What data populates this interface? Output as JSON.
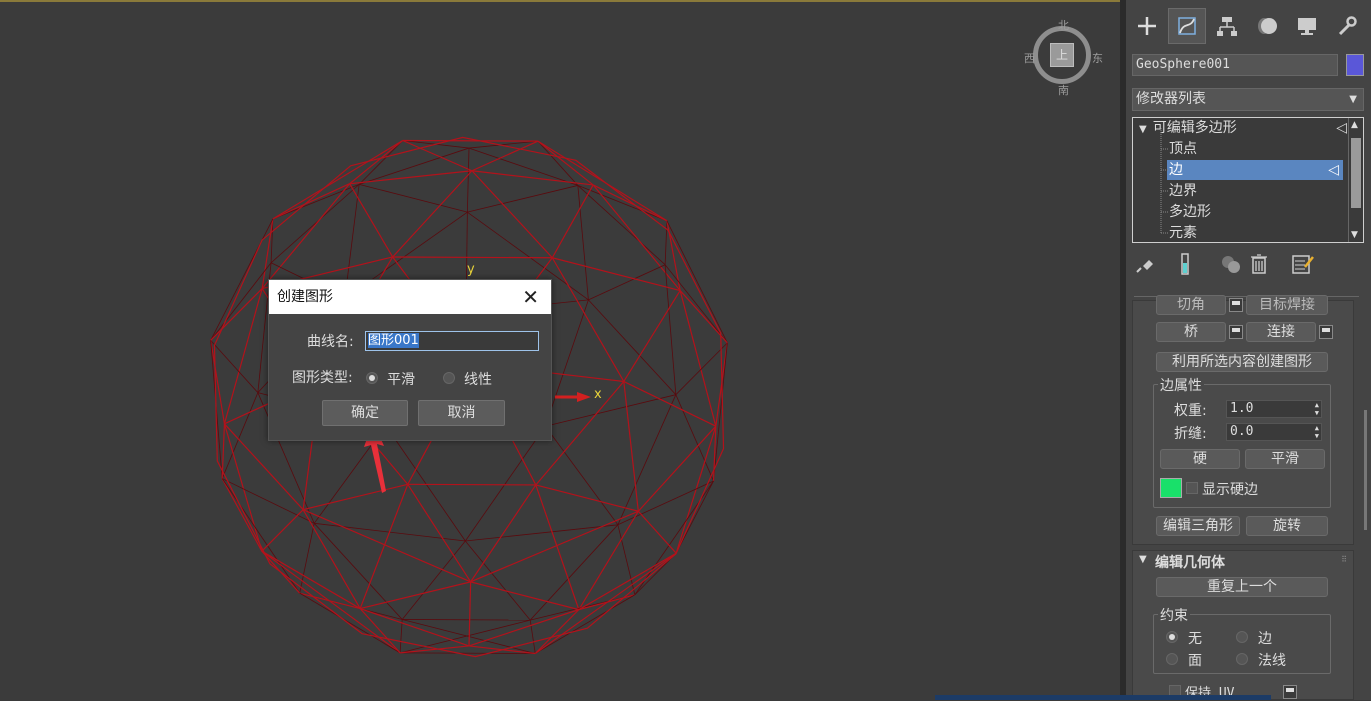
{
  "viewport": {
    "axis_x": "x",
    "axis_y": "y",
    "viewcube": {
      "face": "上",
      "north": "北",
      "south": "南",
      "east": "东",
      "west": "西"
    },
    "wire_color": "#b3121b"
  },
  "command_panel": {
    "tabs": [
      {
        "icon": "plus-icon",
        "label": "创建"
      },
      {
        "icon": "modify-icon",
        "label": "修改"
      },
      {
        "icon": "hierarchy-icon",
        "label": "层次"
      },
      {
        "icon": "motion-icon",
        "label": "运动"
      },
      {
        "icon": "display-icon",
        "label": "显示"
      },
      {
        "icon": "wrench-icon",
        "label": "实用程序"
      }
    ],
    "object_name": "GeoSphere001",
    "object_color": "#5a57d8",
    "modifier_list": "修改器列表",
    "stack": {
      "root": "可编辑多边形",
      "items": [
        "顶点",
        "边",
        "边界",
        "多边形",
        "元素"
      ],
      "selected": "边"
    },
    "edit_edges": {
      "partial_left": "切角",
      "partial_right": "目标焊接",
      "bridge": "桥",
      "connect": "连接",
      "create_shape": "利用所选内容创建图形",
      "edge_props": "边属性",
      "weight_label": "权重:",
      "weight_value": "1.0",
      "crease_label": "折缝:",
      "crease_value": "0.0",
      "hard": "硬",
      "smooth": "平滑",
      "show_hard_edges": "显示硬边",
      "hard_edge_color": "#19e06a",
      "edit_tri": "编辑三角形",
      "turn": "旋转"
    },
    "edit_geometry": {
      "title": "编辑几何体",
      "repeat_last": "重复上一个",
      "constraints": "约束",
      "c_none": "无",
      "c_edge": "边",
      "c_face": "面",
      "c_normal": "法线",
      "preserve_uv": "保持 UV"
    }
  },
  "dialog": {
    "title": "创建图形",
    "name_label": "曲线名:",
    "name_value": "图形001",
    "type_label": "图形类型:",
    "smooth": "平滑",
    "linear": "线性",
    "ok": "确定",
    "cancel": "取消"
  }
}
